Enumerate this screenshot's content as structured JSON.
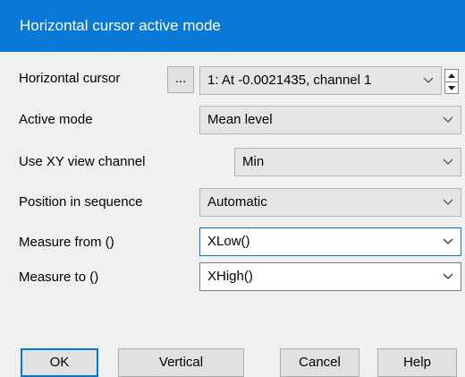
{
  "window": {
    "title": "Horizontal cursor active mode"
  },
  "fields": {
    "horizontal_cursor": {
      "label": "Horizontal cursor",
      "browse": "...",
      "value": "1: At -0.0021435, channel 1"
    },
    "active_mode": {
      "label": "Active mode",
      "value": "Mean level"
    },
    "xy_channel": {
      "label": "Use XY view channel",
      "value": "Min"
    },
    "position": {
      "label": "Position in sequence",
      "value": "Automatic"
    },
    "measure_from": {
      "label": "Measure from ()",
      "value": "XLow()"
    },
    "measure_to": {
      "label": "Measure to ()",
      "value": "XHigh()"
    }
  },
  "buttons": {
    "ok": "OK",
    "vertical": "Vertical",
    "cancel": "Cancel",
    "help": "Help"
  },
  "colors": {
    "titlebar": "#0a78d7",
    "focus": "#0078d7"
  },
  "icons": {
    "dropdown": "chevron-down-icon",
    "spin_up": "arrow-up-icon",
    "spin_down": "arrow-down-icon"
  }
}
